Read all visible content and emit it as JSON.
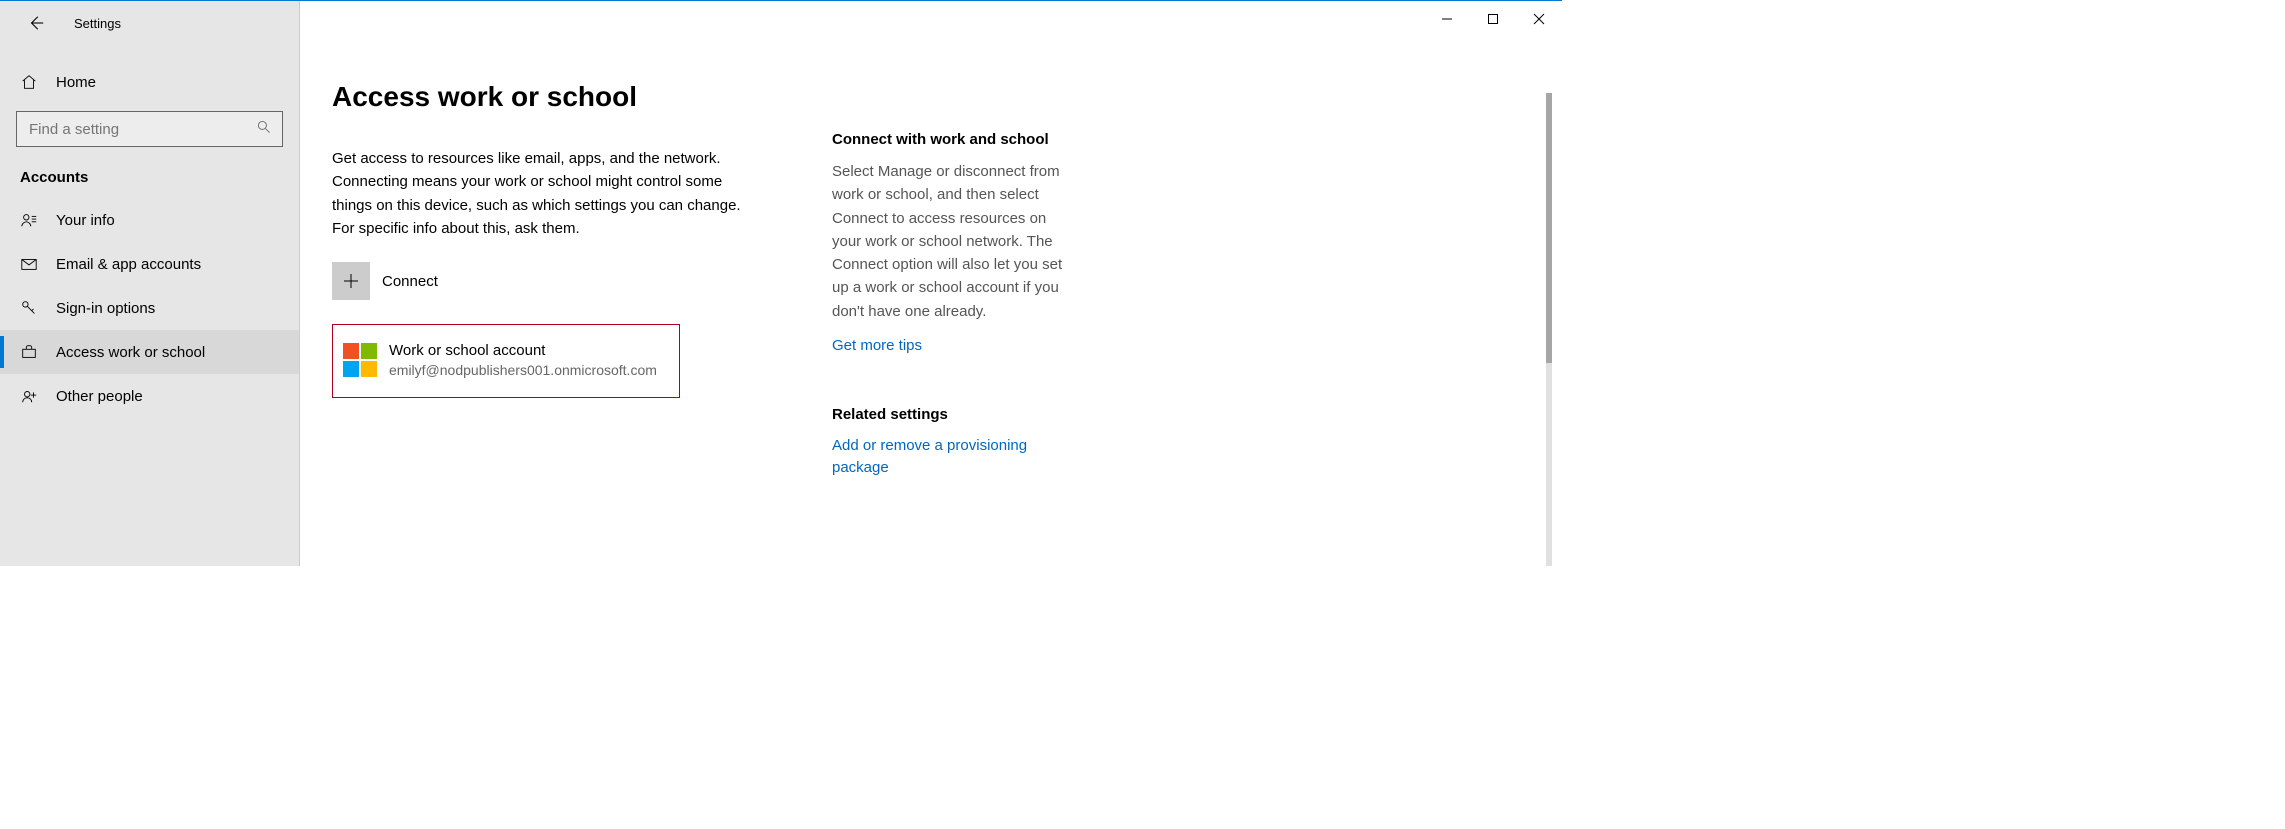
{
  "window": {
    "title": "Settings"
  },
  "sidebar": {
    "home": "Home",
    "searchPlaceholder": "Find a setting",
    "section": "Accounts",
    "items": [
      {
        "label": "Your info"
      },
      {
        "label": "Email & app accounts"
      },
      {
        "label": "Sign-in options"
      },
      {
        "label": "Access work or school"
      },
      {
        "label": "Other people"
      }
    ]
  },
  "main": {
    "title": "Access work or school",
    "description": "Get access to resources like email, apps, and the network. Connecting means your work or school might control some things on this device, such as which settings you can change. For specific info about this, ask them.",
    "connectLabel": "Connect",
    "account": {
      "title": "Work or school account",
      "email": "emilyf@nodpublishers001.onmicrosoft.com"
    }
  },
  "right": {
    "connect": {
      "heading": "Connect with work and school",
      "text": "Select Manage or disconnect from work or school, and then select Connect to access resources on your work or school network. The Connect option will also let you set up a work or school account if you don't have one already.",
      "link": "Get more tips"
    },
    "related": {
      "heading": "Related settings",
      "link": "Add or remove a provisioning package"
    }
  }
}
